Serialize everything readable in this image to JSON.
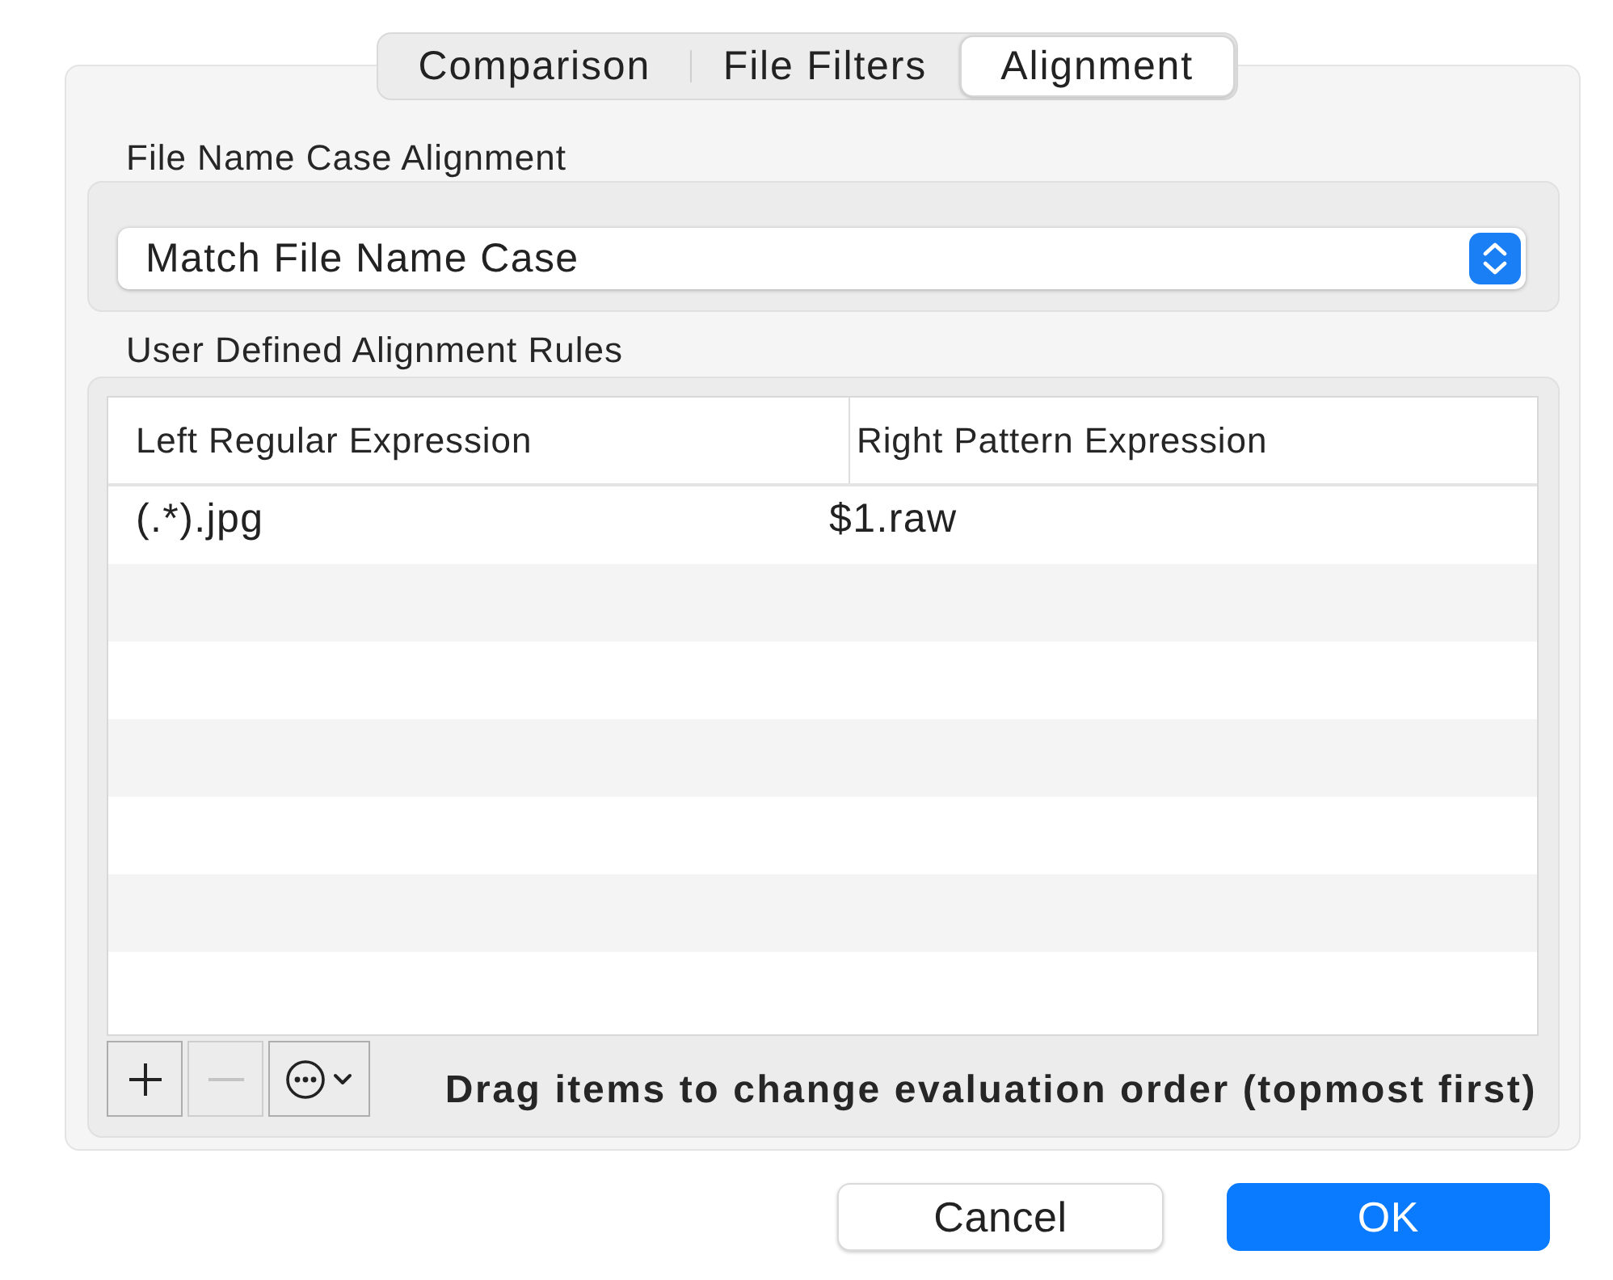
{
  "tabs": [
    {
      "label": "Comparison",
      "selected": false
    },
    {
      "label": "File Filters",
      "selected": false
    },
    {
      "label": "Alignment",
      "selected": true
    }
  ],
  "case_alignment": {
    "label": "File Name Case Alignment",
    "popup": {
      "value": "Match File Name Case"
    }
  },
  "rules": {
    "label": "User Defined Alignment Rules",
    "table": {
      "columns": [
        "Left Regular Expression",
        "Right Pattern Expression"
      ],
      "rows": [
        [
          "(.*).jpg",
          "$1.raw"
        ]
      ]
    },
    "toolbar": [
      {
        "kind": "add",
        "disabled": false
      },
      {
        "kind": "remove",
        "disabled": true
      },
      {
        "kind": "more",
        "disabled": false
      }
    ],
    "hint": "Drag items to change evaluation order (topmost first)"
  },
  "buttons": [
    {
      "label": "Cancel",
      "kind": "secondary"
    },
    {
      "label": "OK",
      "kind": "primary"
    }
  ]
}
